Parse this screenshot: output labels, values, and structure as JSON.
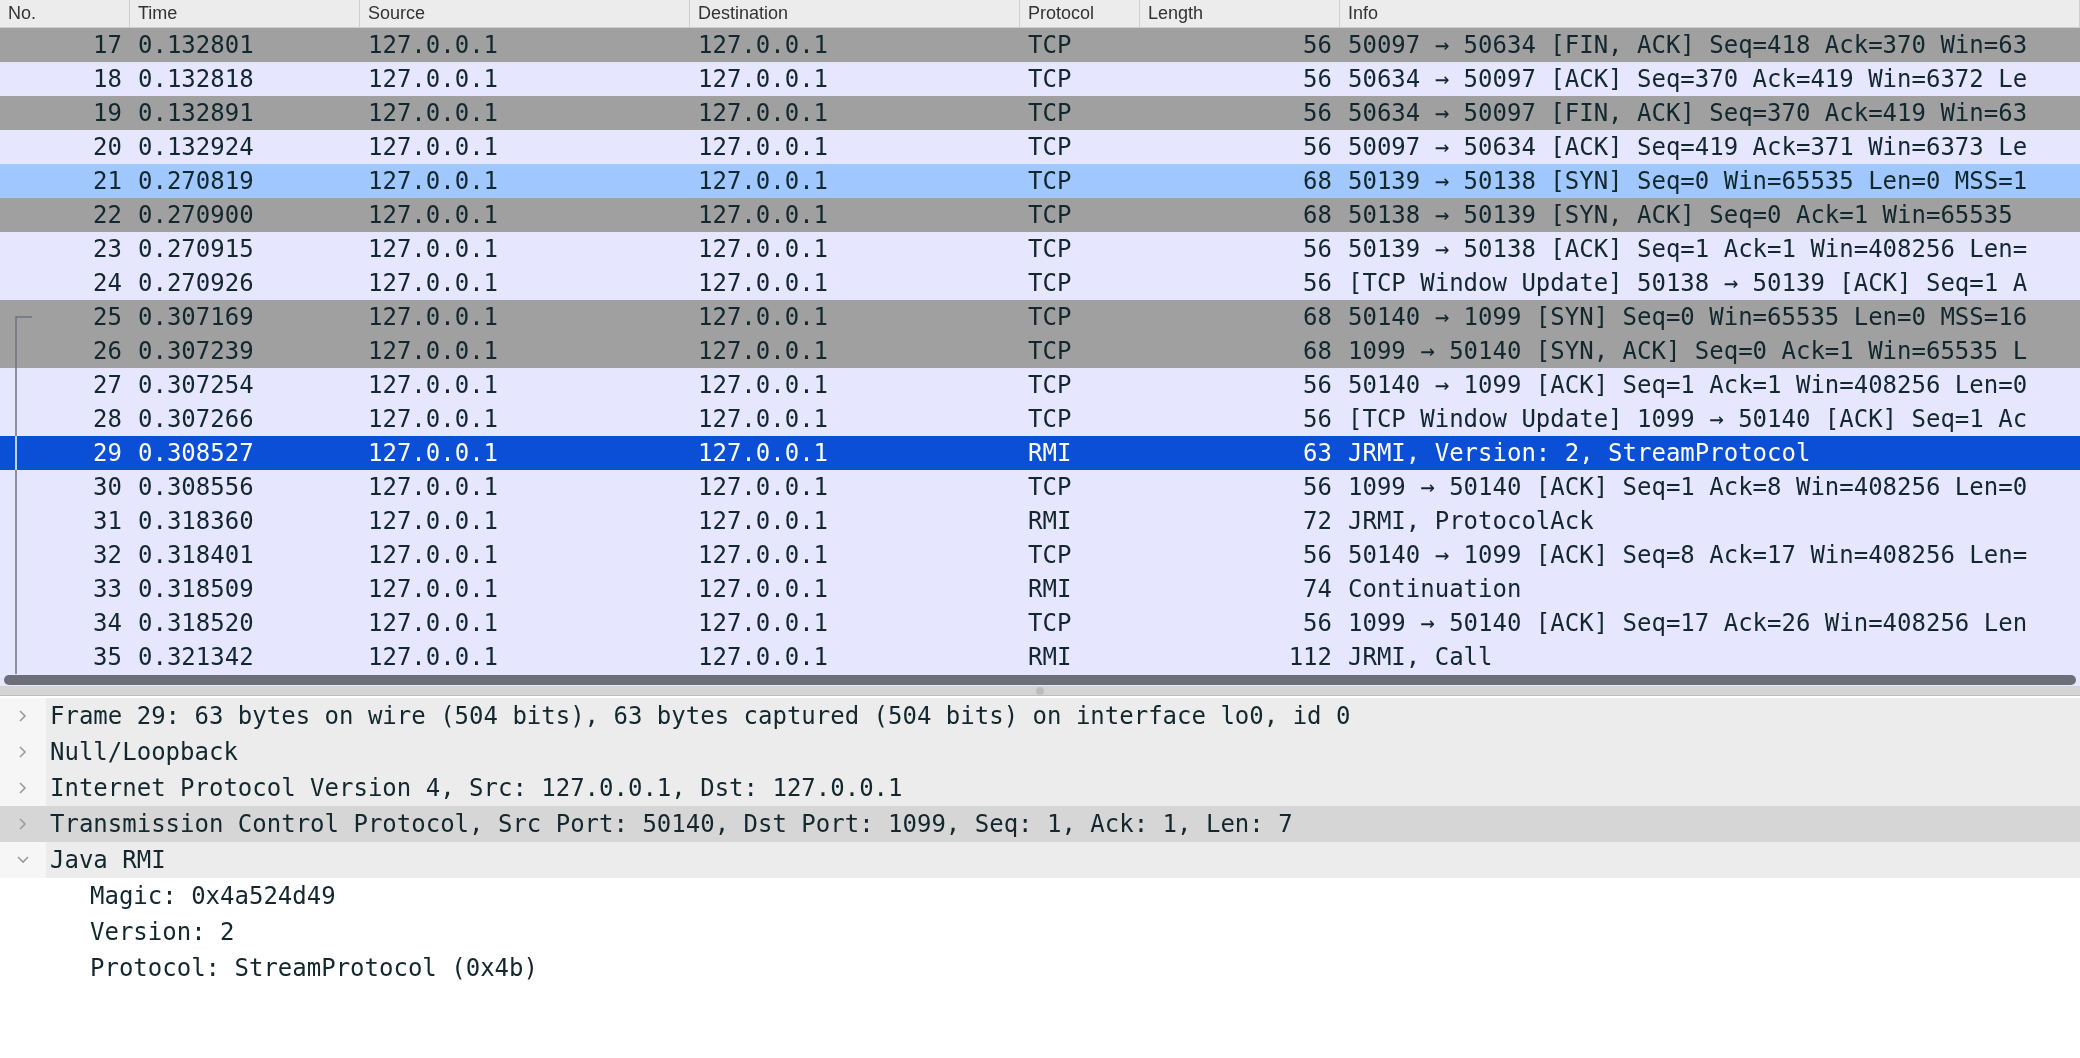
{
  "packet_list": {
    "columns": [
      "No.",
      "Time",
      "Source",
      "Destination",
      "Protocol",
      "Length",
      "Info"
    ],
    "rows": [
      {
        "no": "17",
        "time": "0.132801",
        "source": "127.0.0.1",
        "destination": "127.0.0.1",
        "protocol": "TCP",
        "length": "56",
        "info": "50097 → 50634 [FIN, ACK] Seq=418 Ack=370 Win=63",
        "color": "#a0a0a0",
        "selected": false,
        "related": false,
        "related_start": false
      },
      {
        "no": "18",
        "time": "0.132818",
        "source": "127.0.0.1",
        "destination": "127.0.0.1",
        "protocol": "TCP",
        "length": "56",
        "info": "50634 → 50097 [ACK] Seq=370 Ack=419 Win=6372 Le",
        "color": "#e7e6ff",
        "selected": false,
        "related": false,
        "related_start": false
      },
      {
        "no": "19",
        "time": "0.132891",
        "source": "127.0.0.1",
        "destination": "127.0.0.1",
        "protocol": "TCP",
        "length": "56",
        "info": "50634 → 50097 [FIN, ACK] Seq=370 Ack=419 Win=63",
        "color": "#a0a0a0",
        "selected": false,
        "related": false,
        "related_start": false
      },
      {
        "no": "20",
        "time": "0.132924",
        "source": "127.0.0.1",
        "destination": "127.0.0.1",
        "protocol": "TCP",
        "length": "56",
        "info": "50097 → 50634 [ACK] Seq=419 Ack=371 Win=6373 Le",
        "color": "#e7e6ff",
        "selected": false,
        "related": false,
        "related_start": false
      },
      {
        "no": "21",
        "time": "0.270819",
        "source": "127.0.0.1",
        "destination": "127.0.0.1",
        "protocol": "TCP",
        "length": "68",
        "info": "50139 → 50138 [SYN] Seq=0 Win=65535 Len=0 MSS=1",
        "color": "#a0c8ff",
        "selected": false,
        "related": false,
        "related_start": false
      },
      {
        "no": "22",
        "time": "0.270900",
        "source": "127.0.0.1",
        "destination": "127.0.0.1",
        "protocol": "TCP",
        "length": "68",
        "info": "50138 → 50139 [SYN, ACK] Seq=0 Ack=1 Win=65535",
        "color": "#a0a0a0",
        "selected": false,
        "related": false,
        "related_start": false
      },
      {
        "no": "23",
        "time": "0.270915",
        "source": "127.0.0.1",
        "destination": "127.0.0.1",
        "protocol": "TCP",
        "length": "56",
        "info": "50139 → 50138 [ACK] Seq=1 Ack=1 Win=408256 Len=",
        "color": "#e7e6ff",
        "selected": false,
        "related": false,
        "related_start": false
      },
      {
        "no": "24",
        "time": "0.270926",
        "source": "127.0.0.1",
        "destination": "127.0.0.1",
        "protocol": "TCP",
        "length": "56",
        "info": "[TCP Window Update] 50138 → 50139 [ACK] Seq=1 A",
        "color": "#e7e6ff",
        "selected": false,
        "related": false,
        "related_start": false
      },
      {
        "no": "25",
        "time": "0.307169",
        "source": "127.0.0.1",
        "destination": "127.0.0.1",
        "protocol": "TCP",
        "length": "68",
        "info": "50140 → 1099 [SYN] Seq=0 Win=65535 Len=0 MSS=16",
        "color": "#a0a0a0",
        "selected": false,
        "related": true,
        "related_start": true
      },
      {
        "no": "26",
        "time": "0.307239",
        "source": "127.0.0.1",
        "destination": "127.0.0.1",
        "protocol": "TCP",
        "length": "68",
        "info": "1099 → 50140 [SYN, ACK] Seq=0 Ack=1 Win=65535 L",
        "color": "#a0a0a0",
        "selected": false,
        "related": true,
        "related_start": false
      },
      {
        "no": "27",
        "time": "0.307254",
        "source": "127.0.0.1",
        "destination": "127.0.0.1",
        "protocol": "TCP",
        "length": "56",
        "info": "50140 → 1099 [ACK] Seq=1 Ack=1 Win=408256 Len=0",
        "color": "#e7e6ff",
        "selected": false,
        "related": true,
        "related_start": false
      },
      {
        "no": "28",
        "time": "0.307266",
        "source": "127.0.0.1",
        "destination": "127.0.0.1",
        "protocol": "TCP",
        "length": "56",
        "info": "[TCP Window Update] 1099 → 50140 [ACK] Seq=1 Ac",
        "color": "#e7e6ff",
        "selected": false,
        "related": true,
        "related_start": false
      },
      {
        "no": "29",
        "time": "0.308527",
        "source": "127.0.0.1",
        "destination": "127.0.0.1",
        "protocol": "RMI",
        "length": "63",
        "info": "JRMI, Version: 2, StreamProtocol",
        "selected": true,
        "related": true,
        "related_start": false
      },
      {
        "no": "30",
        "time": "0.308556",
        "source": "127.0.0.1",
        "destination": "127.0.0.1",
        "protocol": "TCP",
        "length": "56",
        "info": "1099 → 50140 [ACK] Seq=1 Ack=8 Win=408256 Len=0",
        "color": "#e7e6ff",
        "selected": false,
        "related": true,
        "related_start": false
      },
      {
        "no": "31",
        "time": "0.318360",
        "source": "127.0.0.1",
        "destination": "127.0.0.1",
        "protocol": "RMI",
        "length": "72",
        "info": "JRMI, ProtocolAck",
        "color": "#e7e6ff",
        "selected": false,
        "related": true,
        "related_start": false
      },
      {
        "no": "32",
        "time": "0.318401",
        "source": "127.0.0.1",
        "destination": "127.0.0.1",
        "protocol": "TCP",
        "length": "56",
        "info": "50140 → 1099 [ACK] Seq=8 Ack=17 Win=408256 Len=",
        "color": "#e7e6ff",
        "selected": false,
        "related": true,
        "related_start": false
      },
      {
        "no": "33",
        "time": "0.318509",
        "source": "127.0.0.1",
        "destination": "127.0.0.1",
        "protocol": "RMI",
        "length": "74",
        "info": "Continuation",
        "color": "#e7e6ff",
        "selected": false,
        "related": true,
        "related_start": false
      },
      {
        "no": "34",
        "time": "0.318520",
        "source": "127.0.0.1",
        "destination": "127.0.0.1",
        "protocol": "TCP",
        "length": "56",
        "info": "1099 → 50140 [ACK] Seq=17 Ack=26 Win=408256 Len",
        "color": "#e7e6ff",
        "selected": false,
        "related": true,
        "related_start": false
      },
      {
        "no": "35",
        "time": "0.321342",
        "source": "127.0.0.1",
        "destination": "127.0.0.1",
        "protocol": "RMI",
        "length": "112",
        "info": "JRMI, Call",
        "color": "#e7e6ff",
        "selected": false,
        "related": true,
        "related_start": false
      }
    ]
  },
  "details": {
    "items": [
      {
        "label": "Frame 29: 63 bytes on wire (504 bits), 63 bytes captured (504 bits) on interface lo0, id 0",
        "expanded": false,
        "selected": false
      },
      {
        "label": "Null/Loopback",
        "expanded": false,
        "selected": false
      },
      {
        "label": "Internet Protocol Version 4, Src: 127.0.0.1, Dst: 127.0.0.1",
        "expanded": false,
        "selected": false
      },
      {
        "label": "Transmission Control Protocol, Src Port: 50140, Dst Port: 1099, Seq: 1, Ack: 1, Len: 7",
        "expanded": false,
        "selected": true
      },
      {
        "label": "Java RMI",
        "expanded": true,
        "selected": false,
        "children": [
          {
            "label": "Magic: 0x4a524d49"
          },
          {
            "label": "Version: 2"
          },
          {
            "label": "Protocol: StreamProtocol (0x4b)"
          }
        ]
      }
    ]
  }
}
